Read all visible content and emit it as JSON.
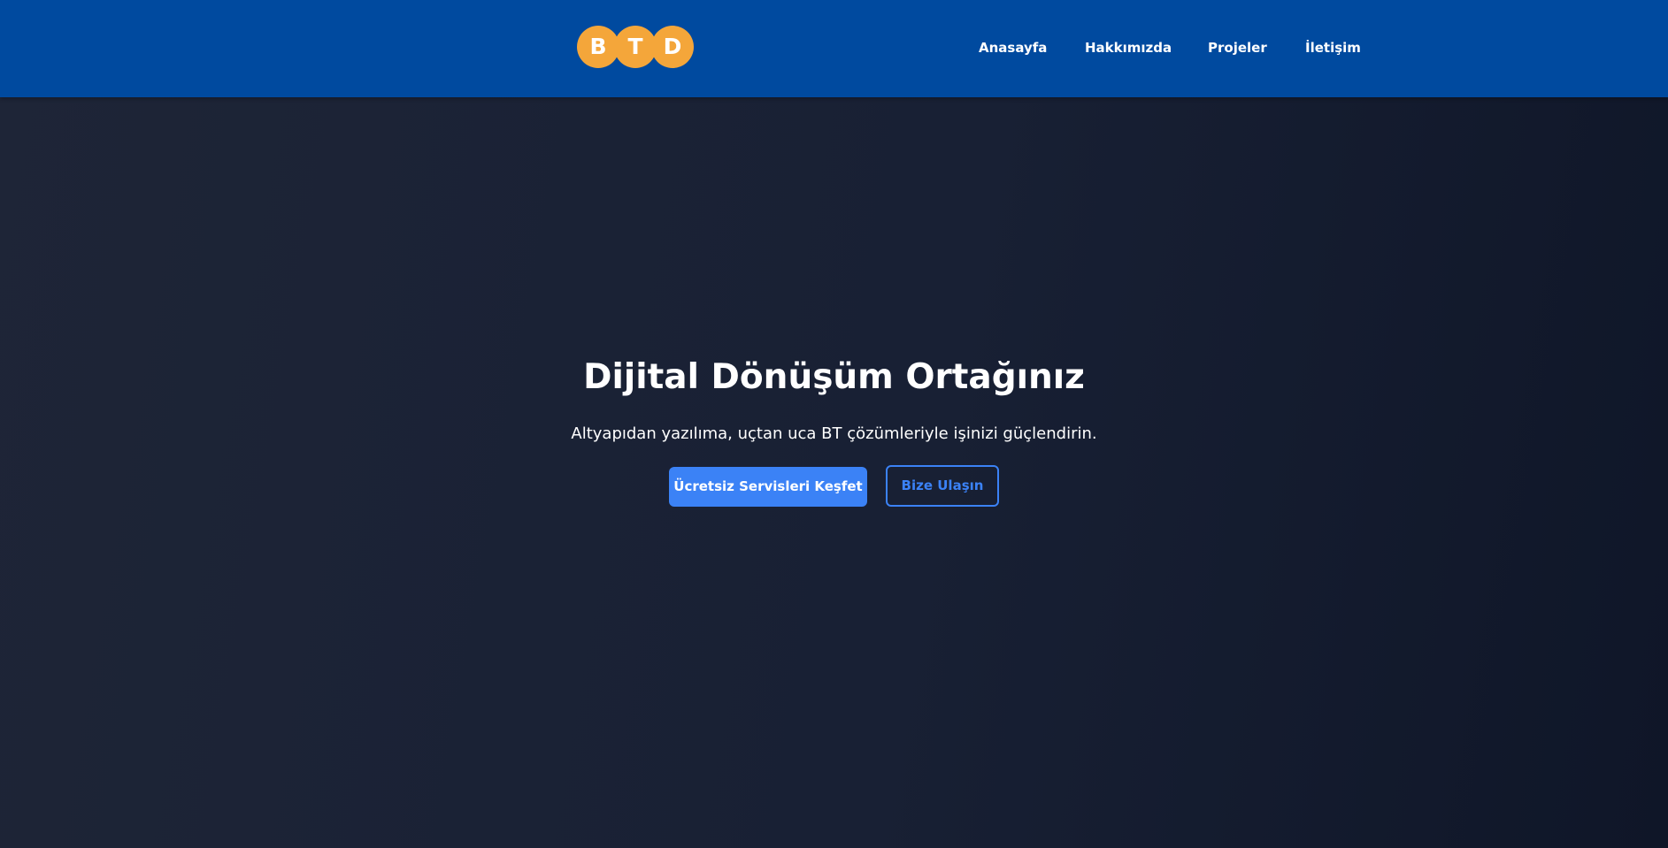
{
  "header": {
    "logo_letters": [
      "B",
      "T",
      "D"
    ],
    "nav": [
      {
        "label": "Anasayfa"
      },
      {
        "label": "Hakkımızda"
      },
      {
        "label": "Projeler"
      },
      {
        "label": "İletişim"
      }
    ]
  },
  "hero": {
    "title": "Dijital Dönüşüm Ortağınız",
    "subtitle": "Altyapıdan yazılıma, uçtan uca BT çözümleriyle işinizi güçlendirin.",
    "primary_button": "Ücretsiz Servisleri Keşfet",
    "secondary_button": "Bize Ulaşın"
  },
  "colors": {
    "header_bg": "#004a9f",
    "logo": "#f4a63a",
    "accent": "#3b82f6",
    "background": "#1b2233"
  }
}
